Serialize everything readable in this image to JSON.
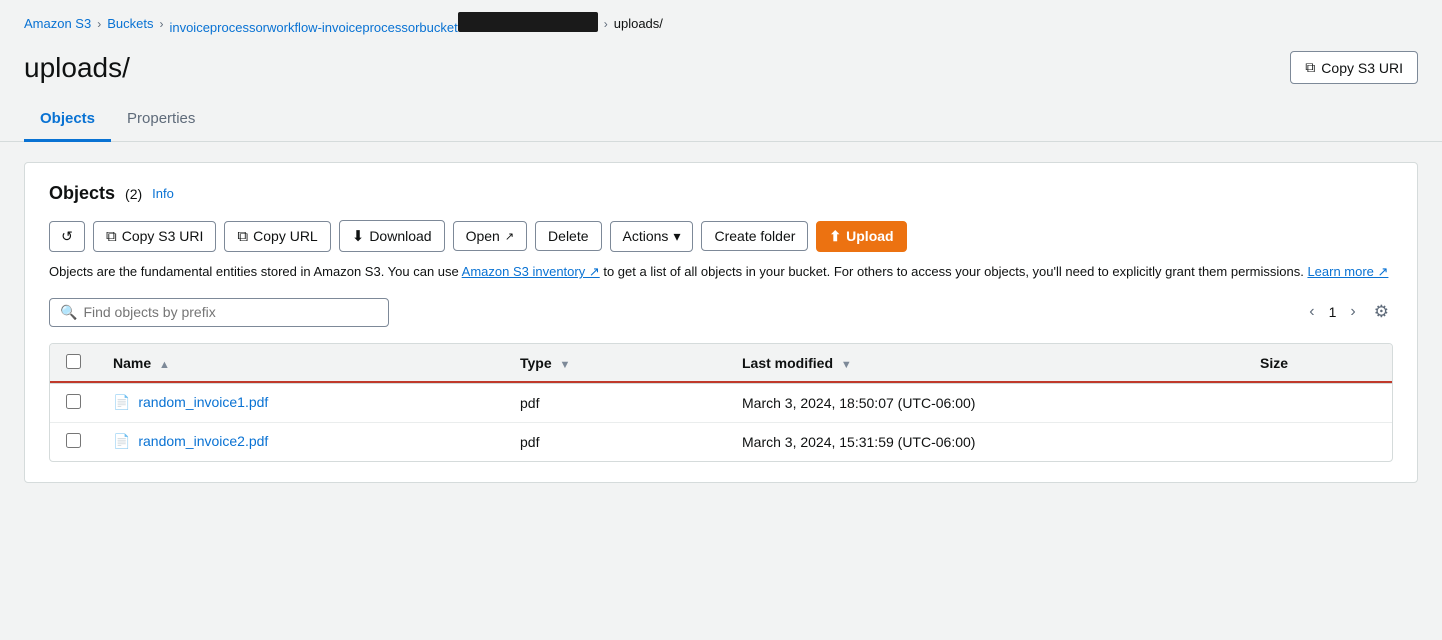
{
  "breadcrumb": {
    "items": [
      {
        "label": "Amazon S3",
        "href": "#"
      },
      {
        "label": "Buckets",
        "href": "#"
      },
      {
        "label": "invoiceprocessorworkflow-invoiceprocessorbucket",
        "href": "#"
      },
      {
        "label": "uploads/",
        "href": null
      }
    ]
  },
  "page": {
    "title": "uploads/",
    "copy_s3_uri_label": "Copy S3 URI"
  },
  "tabs": [
    {
      "label": "Objects",
      "active": true
    },
    {
      "label": "Properties",
      "active": false
    }
  ],
  "objects_panel": {
    "title": "Objects",
    "count": "(2)",
    "info_label": "Info",
    "toolbar": {
      "refresh_label": "",
      "copy_s3_uri_label": "Copy S3 URI",
      "copy_url_label": "Copy URL",
      "download_label": "Download",
      "open_label": "Open",
      "delete_label": "Delete",
      "actions_label": "Actions",
      "create_folder_label": "Create folder",
      "upload_label": "Upload"
    },
    "description": "Objects are the fundamental entities stored in Amazon S3. You can use Amazon S3 inventory to get a list of all objects in your bucket. For others to access your objects, you'll need to explicitly grant them permissions. Learn more",
    "search_placeholder": "Find objects by prefix",
    "pagination": {
      "current_page": "1"
    },
    "table": {
      "columns": [
        {
          "label": "Name",
          "sortable": true,
          "sort_dir": "asc"
        },
        {
          "label": "Type",
          "sortable": true,
          "sort_dir": "desc"
        },
        {
          "label": "Last modified",
          "sortable": true,
          "sort_dir": "desc"
        },
        {
          "label": "Size",
          "sortable": false
        }
      ],
      "rows": [
        {
          "name": "random_invoice1.pdf",
          "type": "pdf",
          "last_modified": "March 3, 2024, 18:50:07 (UTC-06:00)",
          "size": ""
        },
        {
          "name": "random_invoice2.pdf",
          "type": "pdf",
          "last_modified": "March 3, 2024, 15:31:59 (UTC-06:00)",
          "size": ""
        }
      ]
    }
  }
}
